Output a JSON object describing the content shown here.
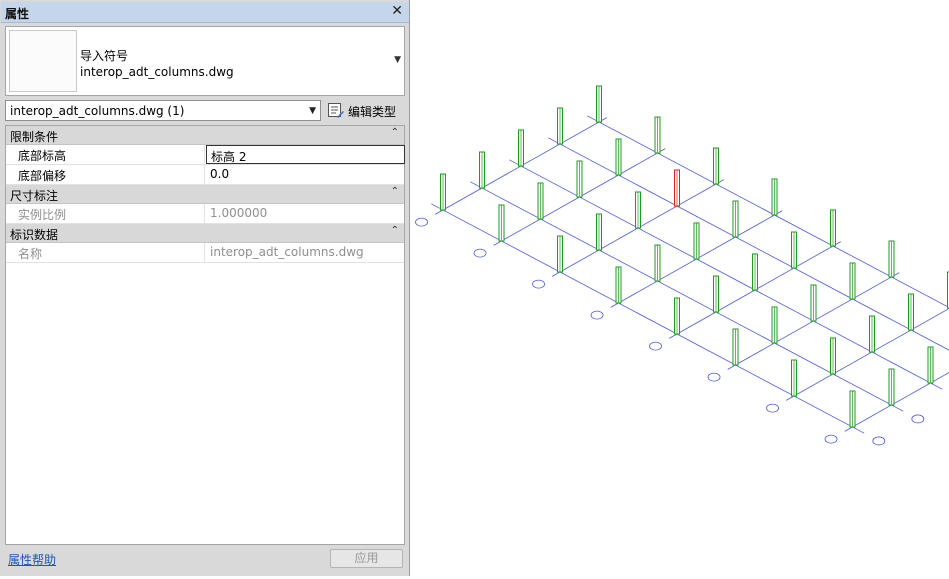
{
  "panel": {
    "title": "属性",
    "close_glyph": "✕",
    "type_selector": {
      "family": "导入符号",
      "name": "interop_adt_columns.dwg"
    },
    "instance_filter": "interop_adt_columns.dwg (1)",
    "edit_type_label": "编辑类型",
    "sections": {
      "constraints": {
        "label": "限制条件",
        "rows": [
          {
            "name": "底部标高",
            "value": "标高 2"
          },
          {
            "name": "底部偏移",
            "value": "0.0"
          }
        ]
      },
      "dimensions": {
        "label": "尺寸标注",
        "rows": [
          {
            "name": "实例比例",
            "value": "1.000000"
          }
        ]
      },
      "identity": {
        "label": "标识数据",
        "rows": [
          {
            "name": "名称",
            "value": "interop_adt_columns.dwg"
          }
        ]
      }
    },
    "help_link": "属性帮助",
    "apply_button": "应用"
  },
  "colors": {
    "grid_line": "#4b5bd6",
    "column_normal": "#1f9a1f",
    "column_selected": "#e02020",
    "bubble": "#4b5bd6"
  },
  "icons": {
    "close": "close-icon",
    "edit_type": "edit-type-icon",
    "collapse": "chevron-up-icon"
  }
}
